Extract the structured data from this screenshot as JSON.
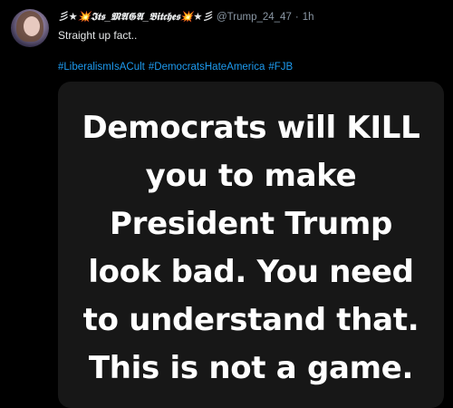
{
  "tweet": {
    "display_name": "彡★💥𝕴𝖙𝖘_𝕸𝕬𝕲𝕬_𝕭𝖎𝖙𝖈𝖍𝖊𝖘💥★彡",
    "handle": "@Trump_24_47",
    "separator": "·",
    "time": "1h",
    "text": "Straight up fact..",
    "hashtags": [
      "#LiberalismIsACult",
      "#DemocratsHateAmerica",
      "#FJB"
    ]
  },
  "media": {
    "lines": [
      "Democrats will KILL",
      "you to make",
      "President Trump",
      "look bad. You need",
      "to understand that.",
      "This is not a game."
    ]
  },
  "colors": {
    "background": "#000000",
    "text": "#e7e9ea",
    "secondary_text": "#8b98a5",
    "link": "#1d9bf0",
    "media_background": "#171717"
  }
}
